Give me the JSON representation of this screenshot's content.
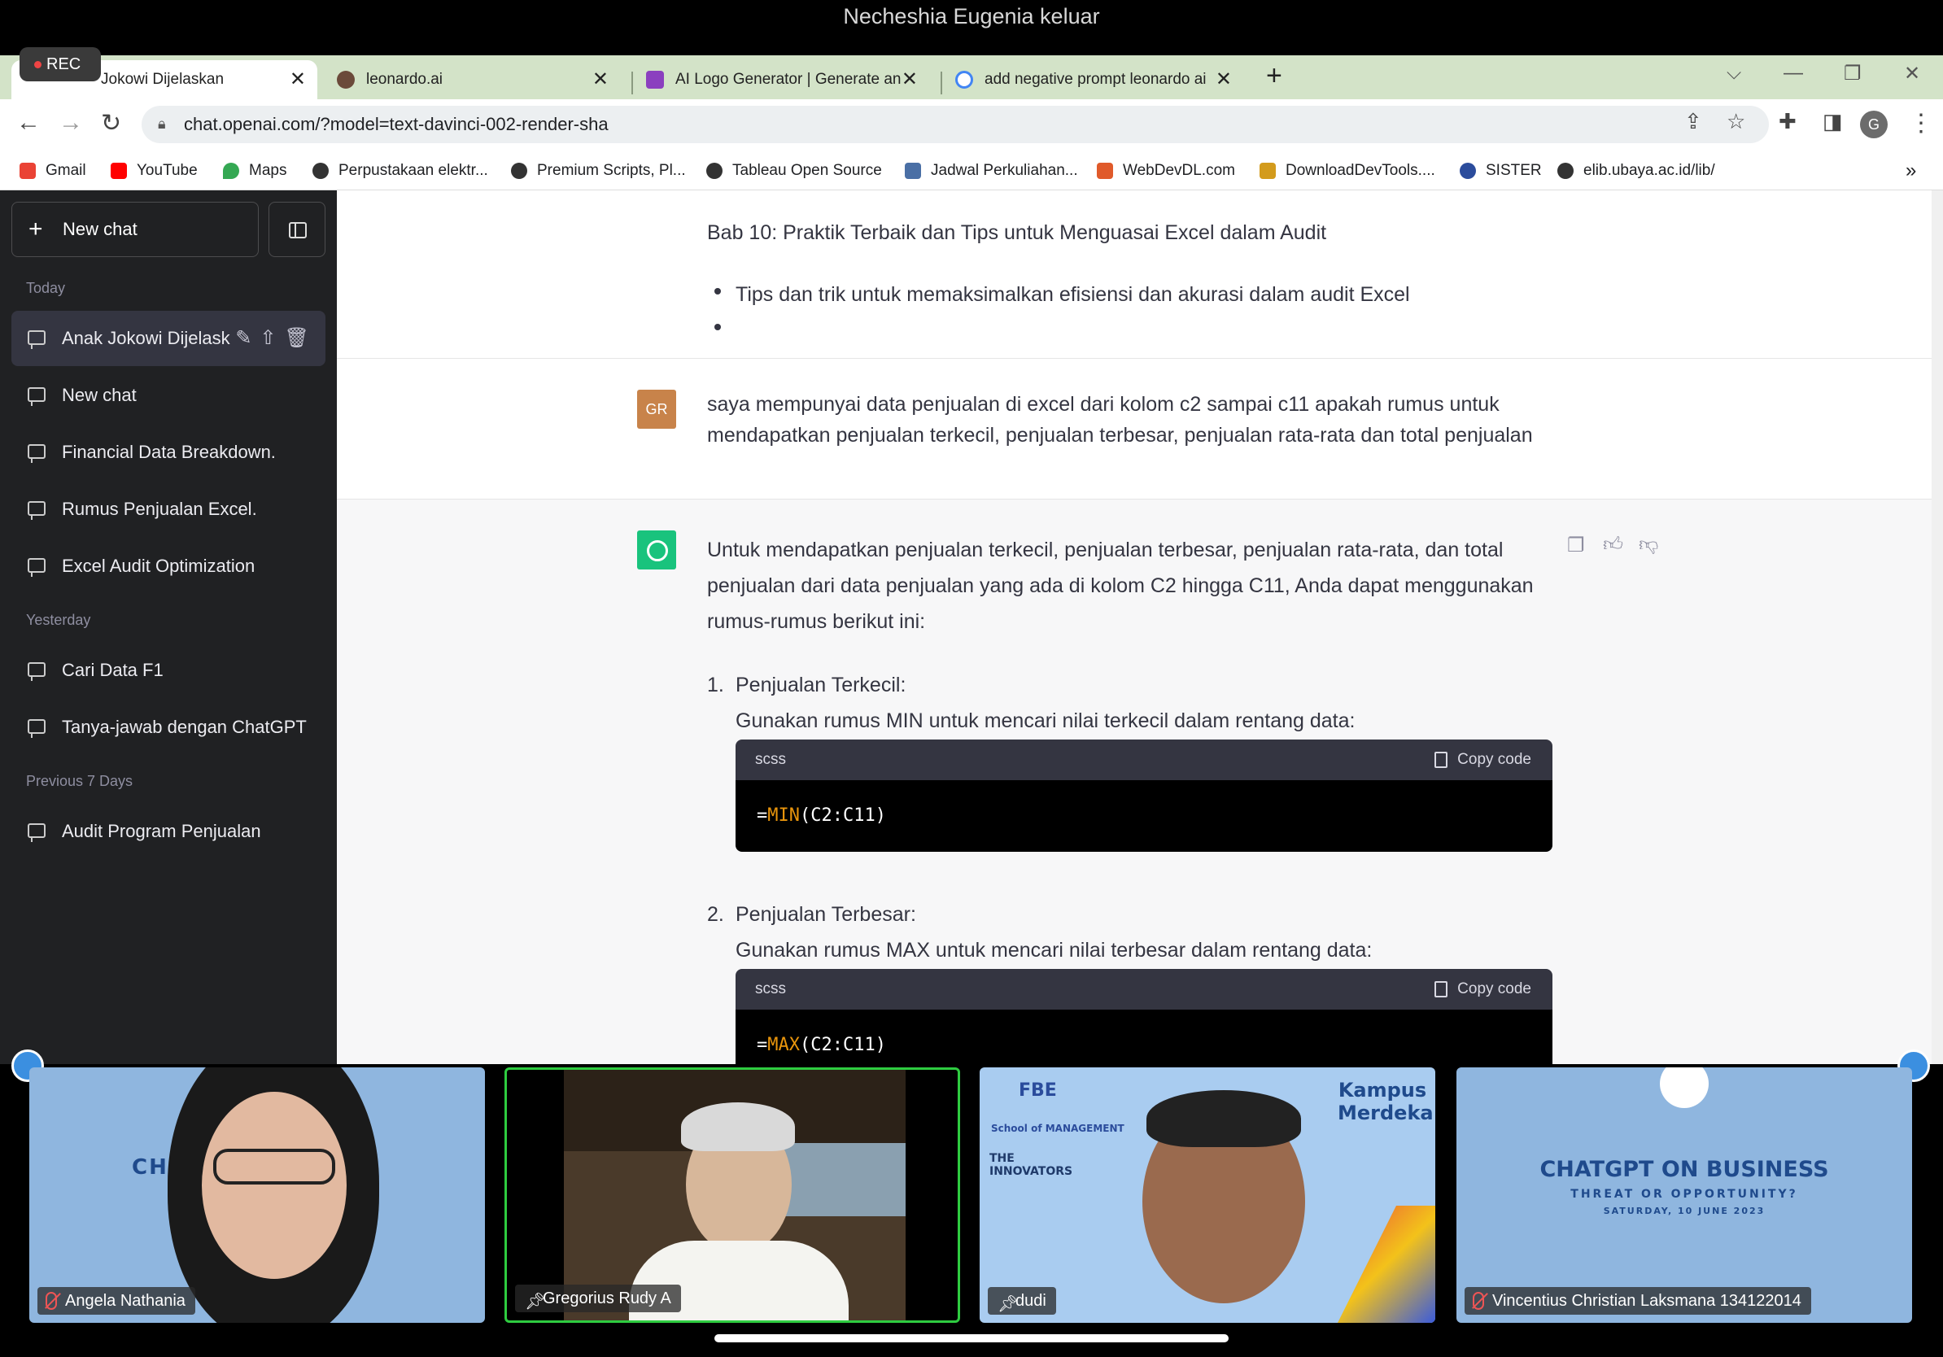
{
  "notification": "Necheshia Eugenia keluar",
  "rec_label": "REC",
  "tabs": [
    {
      "title": "Anak Jokowi Dijelaskan",
      "visible": "Jokowi Dijelaskan",
      "close": "✕"
    },
    {
      "title": "leonardo.ai",
      "close": "✕"
    },
    {
      "title": "AI Logo Generator | Generate an",
      "close": "✕"
    },
    {
      "title": "add negative prompt leonardo ai",
      "close": "✕"
    }
  ],
  "new_tab": "+",
  "address": {
    "url": "chat.openai.com/?model=text-davinci-002-render-sha"
  },
  "bookmarks": [
    {
      "label": "Gmail",
      "color": "#ea4335"
    },
    {
      "label": "YouTube",
      "color": "#ff0000"
    },
    {
      "label": "Maps",
      "color": "#34a853"
    },
    {
      "label": "Perpustakaan elektr...",
      "color": "#333333"
    },
    {
      "label": "Premium Scripts, Pl...",
      "color": "#333333"
    },
    {
      "label": "Tableau Open Source",
      "color": "#333333"
    },
    {
      "label": "Jadwal Perkuliahan...",
      "color": "#4a6fa5"
    },
    {
      "label": "WebDevDL.com",
      "color": "#e05a2a"
    },
    {
      "label": "DownloadDevTools....",
      "color": "#d39b1c"
    },
    {
      "label": "SISTER",
      "color": "#2b4c9c"
    },
    {
      "label": "elib.ubaya.ac.id/lib/",
      "color": "#333333"
    }
  ],
  "bookmarks_more": "»",
  "sidebar": {
    "new_chat": "New chat",
    "sections": {
      "today": "Today",
      "yesterday": "Yesterday",
      "prev7": "Previous 7 Days"
    },
    "today_items": [
      "Anak Jokowi Dijelask",
      "New chat",
      "Financial Data Breakdown.",
      "Rumus Penjualan Excel.",
      "Excel Audit Optimization"
    ],
    "yesterday_items": [
      "Cari Data F1",
      "Tanya-jawab dengan ChatGPT"
    ],
    "prev7_items": [
      "Audit Program Penjualan"
    ]
  },
  "chat": {
    "heading": "Bab 10: Praktik Terbaik dan Tips untuk Menguasai Excel dalam Audit",
    "bullet1": "Tips dan trik untuk memaksimalkan efisiensi dan akurasi dalam audit Excel",
    "user_avatar": "GR",
    "user_msg_line1": "saya mempunyai data penjualan di excel dari kolom c2 sampai c11 apakah rumus untuk",
    "user_msg_line2": "mendapatkan penjualan terkecil, penjualan terbesar, penjualan rata-rata dan total penjualan",
    "ai_intro_line1": "Untuk mendapatkan penjualan terkecil, penjualan terbesar, penjualan rata-rata, dan total",
    "ai_intro_line2": "penjualan dari data penjualan yang ada di kolom C2 hingga C11, Anda dapat menggunakan",
    "ai_intro_line3": "rumus-rumus berikut ini:",
    "items": [
      {
        "num": "1.",
        "title": "Penjualan Terkecil:",
        "desc": "Gunakan rumus MIN untuk mencari nilai terkecil dalam rentang data:",
        "lang": "scss",
        "copy": "Copy code",
        "code_prefix": "=",
        "code_fn": "MIN",
        "code_args": "(C2:C11)"
      },
      {
        "num": "2.",
        "title": "Penjualan Terbesar:",
        "desc": "Gunakan rumus MAX untuk mencari nilai terbesar dalam rentang data:",
        "lang": "scss",
        "copy": "Copy code",
        "code_prefix": "=",
        "code_fn": "MAX",
        "code_args": "(C2:C11)"
      }
    ]
  },
  "video": {
    "participants": [
      {
        "name": "Angela Nathania",
        "muted": true
      },
      {
        "name": "Gregorius Rudy A",
        "muted": false,
        "active_speaker": true
      },
      {
        "name": "dudi",
        "muted": false
      },
      {
        "name": "Vincentius Christian Laksmana 134122014",
        "muted": true
      }
    ],
    "banner_tile1": "CHA          S",
    "banner_tile4_line1": "CHATGPT ON BUSINESS",
    "banner_tile4_line2": "THREAT OR OPPORTUNITY?",
    "banner_tile4_line3": "SATURDAY, 10 JUNE 2023",
    "kampus": "Kampus Merdeka",
    "fbe": "FBE",
    "innovators": "THE INNOVATORS",
    "school": "School of MANAGEMENT"
  }
}
